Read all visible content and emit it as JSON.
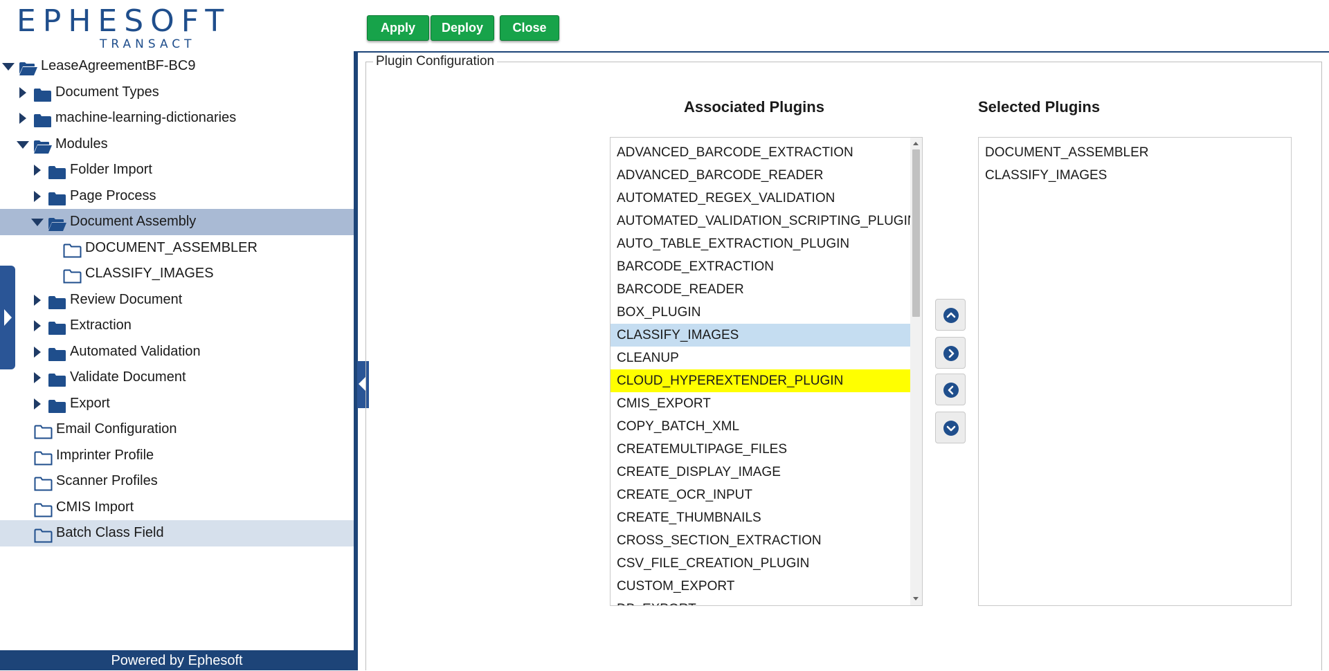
{
  "logo": {
    "word": "EPHESOFT",
    "sub": "TRANSACT"
  },
  "tree": [
    {
      "label": "LeaseAgreementBF-BC9",
      "indent": 0,
      "arrow": "down",
      "folder": "open"
    },
    {
      "label": "Document Types",
      "indent": 1,
      "arrow": "right",
      "folder": "closed"
    },
    {
      "label": "machine-learning-dictionaries",
      "indent": 1,
      "arrow": "right",
      "folder": "closed"
    },
    {
      "label": "Modules",
      "indent": 1,
      "arrow": "down",
      "folder": "open"
    },
    {
      "label": "Folder Import",
      "indent": 2,
      "arrow": "right",
      "folder": "closed"
    },
    {
      "label": "Page Process",
      "indent": 2,
      "arrow": "right",
      "folder": "closed"
    },
    {
      "label": "Document Assembly",
      "indent": 2,
      "arrow": "down",
      "folder": "open",
      "selected": true
    },
    {
      "label": "DOCUMENT_ASSEMBLER",
      "indent": 3,
      "arrow": "none",
      "folder": "outline"
    },
    {
      "label": "CLASSIFY_IMAGES",
      "indent": 3,
      "arrow": "none",
      "folder": "outline"
    },
    {
      "label": "Review Document",
      "indent": 2,
      "arrow": "right",
      "folder": "closed"
    },
    {
      "label": "Extraction",
      "indent": 2,
      "arrow": "right",
      "folder": "closed"
    },
    {
      "label": "Automated Validation",
      "indent": 2,
      "arrow": "right",
      "folder": "closed"
    },
    {
      "label": "Validate Document",
      "indent": 2,
      "arrow": "right",
      "folder": "closed"
    },
    {
      "label": "Export",
      "indent": 2,
      "arrow": "right",
      "folder": "closed"
    },
    {
      "label": "Email Configuration",
      "indent": 1,
      "arrow": "none",
      "folder": "outline"
    },
    {
      "label": "Imprinter Profile",
      "indent": 1,
      "arrow": "none",
      "folder": "outline"
    },
    {
      "label": "Scanner Profiles",
      "indent": 1,
      "arrow": "none",
      "folder": "outline"
    },
    {
      "label": "CMIS Import",
      "indent": 1,
      "arrow": "none",
      "folder": "outline"
    },
    {
      "label": "Batch Class Field",
      "indent": 1,
      "arrow": "none",
      "folder": "outline",
      "hover": true
    }
  ],
  "footer": "Powered by Ephesoft",
  "toolbar": {
    "apply": "Apply",
    "deploy": "Deploy",
    "close": "Close"
  },
  "panel": {
    "legend": "Plugin Configuration",
    "associated_title": "Associated Plugins",
    "selected_title": "Selected Plugins"
  },
  "associated_plugins": [
    "ADVANCED_BARCODE_EXTRACTION",
    "ADVANCED_BARCODE_READER",
    "AUTOMATED_REGEX_VALIDATION",
    "AUTOMATED_VALIDATION_SCRIPTING_PLUGIN",
    "AUTO_TABLE_EXTRACTION_PLUGIN",
    "BARCODE_EXTRACTION",
    "BARCODE_READER",
    "BOX_PLUGIN",
    "CLASSIFY_IMAGES",
    "CLEANUP",
    "CLOUD_HYPEREXTENDER_PLUGIN",
    "CMIS_EXPORT",
    "COPY_BATCH_XML",
    "CREATEMULTIPAGE_FILES",
    "CREATE_DISPLAY_IMAGE",
    "CREATE_OCR_INPUT",
    "CREATE_THUMBNAILS",
    "CROSS_SECTION_EXTRACTION",
    "CSV_FILE_CREATION_PLUGIN",
    "CUSTOM_EXPORT",
    "DB_EXPORT"
  ],
  "associated_selected": "CLASSIFY_IMAGES",
  "associated_hovered": "CLOUD_HYPEREXTENDER_PLUGIN",
  "selected_plugins": [
    "DOCUMENT_ASSEMBLER",
    "CLASSIFY_IMAGES"
  ],
  "colors": {
    "accent": "#1d4478",
    "button_green": "#17a34a",
    "selected_row": "#c5ddf1",
    "hover_row": "#ffff00"
  }
}
